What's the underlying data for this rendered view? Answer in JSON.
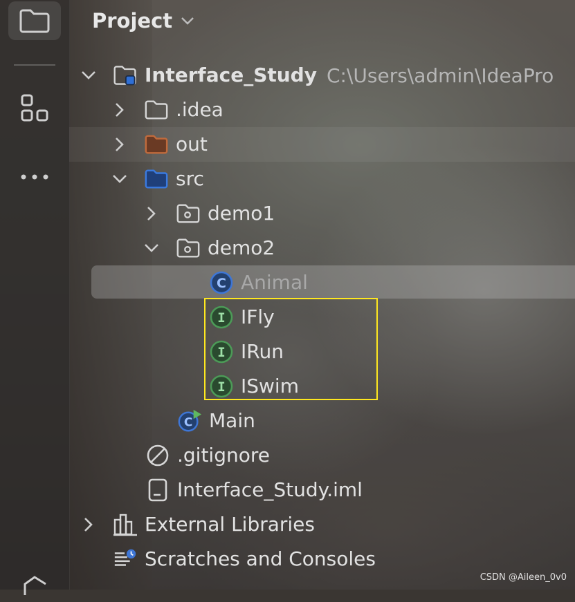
{
  "header": {
    "title": "Project"
  },
  "tree": {
    "rows": [
      {
        "label": "Interface_Study",
        "path": "C:\\Users\\admin\\IdeaPro"
      },
      {
        "label": ".idea"
      },
      {
        "label": "out"
      },
      {
        "label": "src"
      },
      {
        "label": "demo1"
      },
      {
        "label": "demo2"
      },
      {
        "label": "Animal"
      },
      {
        "label": "IFly"
      },
      {
        "label": "IRun"
      },
      {
        "label": "ISwim"
      },
      {
        "label": "Main"
      },
      {
        "label": ".gitignore"
      },
      {
        "label": "Interface_Study.iml"
      },
      {
        "label": "External Libraries"
      },
      {
        "label": "Scratches and Consoles"
      }
    ]
  },
  "icons": {
    "folder": "folder-icon",
    "project": "project-folder-icon",
    "excluded": "excluded-folder-icon",
    "source": "source-folder-icon",
    "package": "package-icon",
    "class": "class-icon",
    "interface": "interface-icon",
    "main": "main-class-icon",
    "ignore": "ignored-file-icon",
    "module": "module-file-icon",
    "libraries": "libraries-icon",
    "scratches": "scratches-icon"
  },
  "colors": {
    "highlight": "#ffe81f",
    "class": "#3e76d6",
    "interface": "#4c9a57",
    "source_folder": "#2f6fd6",
    "excluded_folder": "#c06a3c"
  },
  "watermark": "CSDN @Aileen_0v0"
}
